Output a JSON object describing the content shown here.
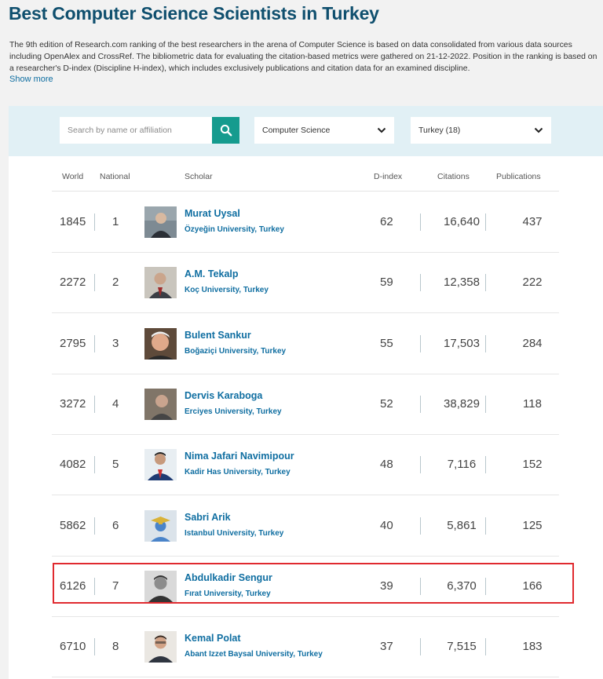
{
  "page": {
    "title": "Best Computer Science Scientists in Turkey",
    "intro": "The 9th edition of Research.com ranking of the best researchers in the arena of Computer Science is based on data consolidated from various data sources including OpenAlex and CrossRef. The bibliometric data for evaluating the citation-based metrics were gathered on 21-12-2022. Position in the ranking is based on a researcher's D-index (Discipline H-index), which includes exclusively publications and citation data for an examined discipline.",
    "show_more": "Show more"
  },
  "filters": {
    "search_placeholder": "Search by name or affiliation",
    "discipline": "Computer Science",
    "country": "Turkey (18)"
  },
  "table": {
    "headers": {
      "world": "World",
      "national": "National",
      "scholar": "Scholar",
      "dindex": "D-index",
      "citations": "Citations",
      "publications": "Publications"
    },
    "rows": [
      {
        "world": "1845",
        "national": "1",
        "name": "Murat Uysal",
        "affiliation": "Özyeğin University, Turkey",
        "dindex": "62",
        "citations": "16,640",
        "publications": "437"
      },
      {
        "world": "2272",
        "national": "2",
        "name": "A.M. Tekalp",
        "affiliation": "Koç University, Turkey",
        "dindex": "59",
        "citations": "12,358",
        "publications": "222"
      },
      {
        "world": "2795",
        "national": "3",
        "name": "Bulent Sankur",
        "affiliation": "Boğaziçi University, Turkey",
        "dindex": "55",
        "citations": "17,503",
        "publications": "284"
      },
      {
        "world": "3272",
        "national": "4",
        "name": "Dervis Karaboga",
        "affiliation": "Erciyes University, Turkey",
        "dindex": "52",
        "citations": "38,829",
        "publications": "118"
      },
      {
        "world": "4082",
        "national": "5",
        "name": "Nima Jafari Navimipour",
        "affiliation": "Kadir Has University, Turkey",
        "dindex": "48",
        "citations": "7,116",
        "publications": "152"
      },
      {
        "world": "5862",
        "national": "6",
        "name": "Sabri Arik",
        "affiliation": "Istanbul University, Turkey",
        "dindex": "40",
        "citations": "5,861",
        "publications": "125"
      },
      {
        "world": "6126",
        "national": "7",
        "name": "Abdulkadir Sengur",
        "affiliation": "Fırat University, Turkey",
        "dindex": "39",
        "citations": "6,370",
        "publications": "166"
      },
      {
        "world": "6710",
        "national": "8",
        "name": "Kemal Polat",
        "affiliation": "Abant Izzet Baysal University, Turkey",
        "dindex": "37",
        "citations": "7,515",
        "publications": "183"
      }
    ]
  },
  "colors": {
    "title": "#0f4f6e",
    "link": "#0f6ea1",
    "search_button": "#159b8e",
    "filter_bar": "#e1f0f5",
    "highlight_border": "#e02a2f"
  },
  "highlighted_scholar": "Abdulkadir Sengur"
}
